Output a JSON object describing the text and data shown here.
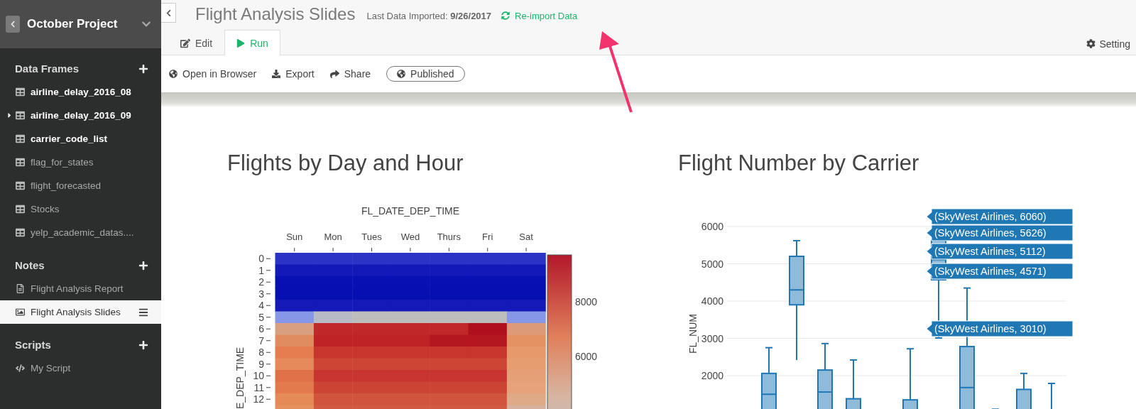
{
  "sidebar": {
    "project": "October Project",
    "sections": [
      {
        "title": "Data Frames",
        "items": [
          {
            "label": "airline_delay_2016_08",
            "kind": "table",
            "loaded": true,
            "open": false,
            "selected": false
          },
          {
            "label": "airline_delay_2016_09",
            "kind": "table",
            "loaded": true,
            "open": true,
            "selected": false
          },
          {
            "label": "carrier_code_list",
            "kind": "table",
            "loaded": true,
            "open": false,
            "selected": false
          },
          {
            "label": "flag_for_states",
            "kind": "table",
            "loaded": false,
            "open": false,
            "selected": false
          },
          {
            "label": "flight_forecasted",
            "kind": "table",
            "loaded": false,
            "open": false,
            "selected": false
          },
          {
            "label": "Stocks",
            "kind": "table",
            "loaded": false,
            "open": false,
            "selected": false
          },
          {
            "label": "yelp_academic_datas....",
            "kind": "table",
            "loaded": false,
            "open": false,
            "selected": false
          }
        ]
      },
      {
        "title": "Notes",
        "items": [
          {
            "label": "Flight Analysis Report",
            "kind": "note",
            "selected": false
          },
          {
            "label": "Flight Analysis Slides",
            "kind": "slides",
            "selected": true
          }
        ]
      },
      {
        "title": "Scripts",
        "items": [
          {
            "label": "My Script",
            "kind": "script",
            "selected": false
          }
        ]
      }
    ]
  },
  "header": {
    "title": "Flight Analysis Slides",
    "imported": "Last Data Imported: **9/26/2017**",
    "reimport": "Re-import Data"
  },
  "tabs": [
    {
      "label": "Edit",
      "kind": "edit",
      "selected": false
    },
    {
      "label": "Run",
      "kind": "run",
      "selected": true
    }
  ],
  "setting": "Setting",
  "toolbar": [
    {
      "label": "Open in Browser",
      "kind": "globe"
    },
    {
      "label": "Export",
      "kind": "export"
    },
    {
      "label": "Share",
      "kind": "share"
    },
    {
      "label": "Published",
      "kind": "status"
    }
  ],
  "slides": [
    {
      "title": "Flights by Day and Hour",
      "kind": "heatmap",
      "xlabel": "FL_DATE_DEP_TIME",
      "ylabel": "E_DEP_TIME",
      "columns": [
        "Sun",
        "Mon",
        "Tues",
        "Wed",
        "Thurs",
        "Fri",
        "Sat"
      ],
      "rows": [
        "0",
        "1",
        "2",
        "3",
        "4",
        "5",
        "6",
        "7",
        "8",
        "9",
        "10",
        "11",
        "12"
      ],
      "colorbar_ticks": [
        "8000",
        "6000"
      ]
    },
    {
      "title": "Flight Number by Carrier",
      "kind": "boxplot",
      "ylabel": "FL_NUM",
      "yticks": [
        "6000",
        "5000",
        "4000",
        "3000",
        "2000"
      ],
      "tooltips": [
        "(SkyWest Airlines, 6060)",
        "(SkyWest Airlines, 5626)",
        "(SkyWest Airlines, 5112)",
        "(SkyWest Airlines, 4571)",
        "(SkyWest Airlines, 3010)"
      ]
    }
  ]
}
